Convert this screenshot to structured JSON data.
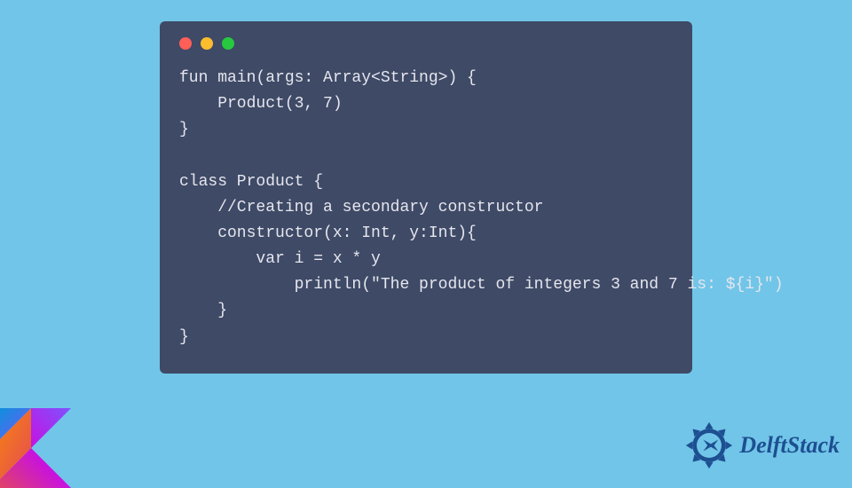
{
  "code": {
    "lines": [
      "fun main(args: Array<String>) {",
      "    Product(3, 7)",
      "}",
      "",
      "class Product {",
      "    //Creating a secondary constructor",
      "    constructor(x: Int, y:Int){",
      "        var i = x * y",
      "            println(\"The product of integers 3 and 7 is: ${i}\")",
      "    }",
      "}"
    ]
  },
  "window": {
    "dot_colors": {
      "red": "#ff5f56",
      "yellow": "#ffbd2e",
      "green": "#27c93f"
    }
  },
  "brand": {
    "name": "DelftStack"
  },
  "colors": {
    "page_bg": "#71c5e8",
    "code_bg": "#3e4a66",
    "code_fg": "#e6e6ee",
    "brand_blue": "#1d4f91"
  }
}
